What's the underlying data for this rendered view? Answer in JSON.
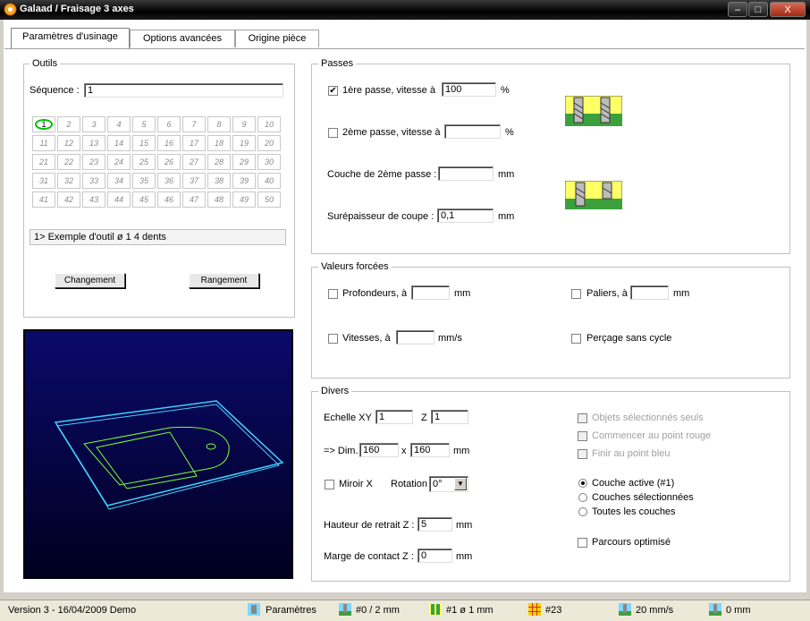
{
  "window": {
    "title": "Galaad / Fraisage 3 axes",
    "min": "–",
    "max": "□",
    "close": "X"
  },
  "tabs": [
    "Paramètres d'usinage",
    "Options avancées",
    "Origine pièce"
  ],
  "outils": {
    "legend": "Outils",
    "sequence_label": "Séquence :",
    "sequence_value": "1",
    "tool_numbers": [
      1,
      2,
      3,
      4,
      5,
      6,
      7,
      8,
      9,
      10,
      11,
      12,
      13,
      14,
      15,
      16,
      17,
      18,
      19,
      20,
      21,
      22,
      23,
      24,
      25,
      26,
      27,
      28,
      29,
      30,
      31,
      32,
      33,
      34,
      35,
      36,
      37,
      38,
      39,
      40,
      41,
      42,
      43,
      44,
      45,
      46,
      47,
      48,
      49,
      50
    ],
    "tool_info": "1>  Exemple d'outil   ø 1    4 dents",
    "changement": "Changement",
    "rangement": "Rangement"
  },
  "passes": {
    "legend": "Passes",
    "pass1_label": "1ère passe, vitesse à",
    "pass1_checked": true,
    "pass1_value": "100",
    "pass1_unit": "%",
    "pass2_label": "2ème passe, vitesse à",
    "pass2_checked": false,
    "pass2_value": "",
    "pass2_unit": "%",
    "couche_label": "Couche de 2ème passe :",
    "couche_value": "",
    "couche_unit": "mm",
    "surep_label": "Surépaisseur de coupe :",
    "surep_value": "0,1",
    "surep_unit": "mm"
  },
  "valeurs": {
    "legend": "Valeurs forcées",
    "prof_label": "Profondeurs, à",
    "prof_unit": "mm",
    "paliers_label": "Paliers, à",
    "paliers_unit": "mm",
    "vitesses_label": "Vitesses, à",
    "vitesses_unit": "mm/s",
    "percage_label": "Perçage sans cycle"
  },
  "divers": {
    "legend": "Divers",
    "echelle_label": "Echelle XY",
    "echelle_value": "1",
    "z_label": "Z",
    "z_value": "1",
    "dim_label": "=> Dim.",
    "dim_x": "160",
    "dim_sep": "x",
    "dim_y": "160",
    "dim_unit": "mm",
    "miroir_label": "Miroir X",
    "rotation_label": "Rotation",
    "rotation_value": "0°",
    "hauteur_label": "Hauteur de retrait Z :",
    "hauteur_value": "5",
    "hauteur_unit": "mm",
    "marge_label": "Marge de contact Z :",
    "marge_value": "0",
    "marge_unit": "mm",
    "objets_label": "Objets sélectionnés seuls",
    "commencer_label": "Commencer au point rouge",
    "finir_label": "Finir au point bleu",
    "couche_active": "Couche active (#1)",
    "couches_sel": "Couches sélectionnées",
    "toutes": "Toutes les couches",
    "parcours": "Parcours optimisé"
  },
  "status": {
    "version": "Version 3 - 16/04/2009  Demo",
    "parametres": "Paramètres",
    "item2": "#0 / 2 mm",
    "item3": "#1  ø 1 mm",
    "item4": "#23",
    "item5": "20 mm/s",
    "item6": "0 mm"
  },
  "colors": {
    "accent_green": "#00c000",
    "preview_bg": "#0a0a6a",
    "wire_green": "#7fff3a",
    "wire_cyan": "#40d0ff"
  }
}
